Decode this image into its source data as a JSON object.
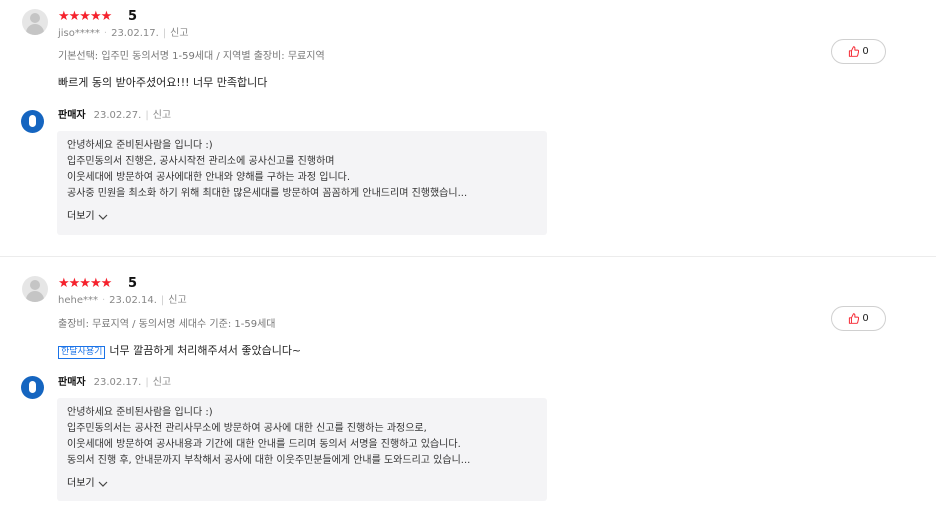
{
  "reviews": [
    {
      "stars": "★★★★★",
      "score": "5",
      "user": "jiso*****",
      "date": "23.02.17.",
      "report": "신고",
      "option": "기본선택: 입주민 동의서명 1-59세대 / 지역별 출장비: 무료지역",
      "tag": "",
      "text": "빠르게 동의 받아주셨어요!!! 너무 만족합니다",
      "likes": "0",
      "reply": {
        "name": "판매자",
        "date": "23.02.27.",
        "report": "신고",
        "lines": [
          "안녕하세요 준비된사람을 입니다 :)",
          "입주민동의서 진행은, 공사시작전 관리소에 공사신고를 진행하며",
          "이웃세대에 방문하여 공사에대한 안내와 양해를 구하는 과정 입니다.",
          "공사중 민원을 최소화 하기 위해 최대한 많은세대를 방문하여 꼼꼼하게 안내드리며 진행했습니..."
        ],
        "more": "더보기"
      }
    },
    {
      "stars": "★★★★★",
      "score": "5",
      "user": "hehe***",
      "date": "23.02.14.",
      "report": "신고",
      "option": "출장비: 무료지역 / 동의서명 세대수 기준: 1-59세대",
      "tag": "한달사용기",
      "text": "너무 깔끔하게 처리해주셔서 좋았습니다~",
      "likes": "0",
      "reply": {
        "name": "판매자",
        "date": "23.02.17.",
        "report": "신고",
        "lines": [
          "안녕하세요 준비된사람을 입니다 :)",
          "입주민동의서는 공사전 관리사무소에 방문하여 공사에 대한 신고를 진행하는 과정으로,",
          "이웃세대에 방문하여 공사내용과 기간에 대한 안내를 드리며 동의서 서명을 진행하고 있습니다.",
          "동의서 진행 후, 안내문까지 부착해서 공사에 대한 이웃주민분들에게 안내를 도와드리고 있습니..."
        ],
        "more": "더보기"
      }
    }
  ],
  "colors": {
    "star": "#f5222d",
    "seller_icon": "#1565c0",
    "tag": "#1a73e8",
    "reply_bg": "#f4f4f6"
  },
  "icons": {
    "like": "thumbs-up-icon",
    "more": "chevron-down-icon"
  }
}
